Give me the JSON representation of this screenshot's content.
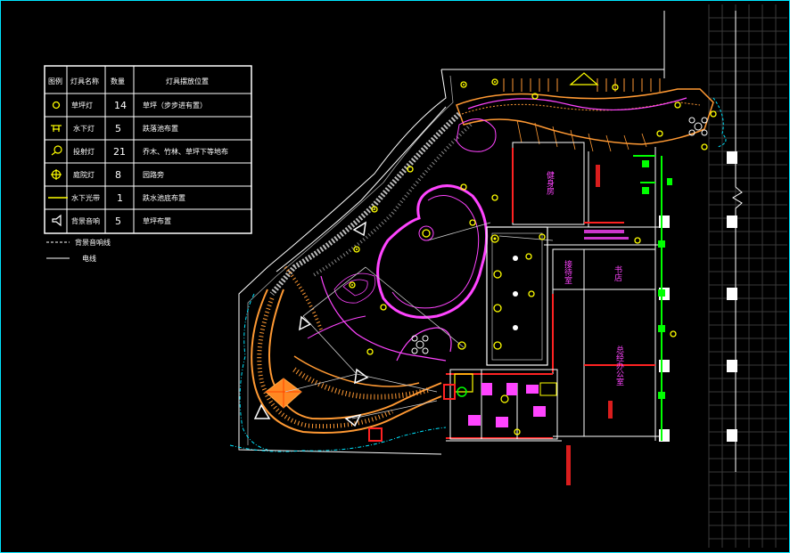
{
  "legend": {
    "headers": {
      "symbol": "图例",
      "name": "灯具名称",
      "qty": "数量",
      "position": "灯具摆放位置"
    },
    "rows": [
      {
        "icon": "lawn-lamp-icon",
        "name": "草坪灯",
        "qty": "14",
        "position": "草坪（步步进有置）"
      },
      {
        "icon": "underwater-lamp-icon",
        "name": "水下灯",
        "qty": "5",
        "position": "跌落池布置"
      },
      {
        "icon": "uplight-icon",
        "name": "投射灯",
        "qty": "21",
        "position": "乔木、竹林、草坪下等地布"
      },
      {
        "icon": "garden-lamp-icon",
        "name": "庭院灯",
        "qty": "8",
        "position": "园路旁"
      },
      {
        "icon": "underwater-strip-icon",
        "name": "水下光带",
        "qty": "1",
        "position": "跌水池底布置"
      },
      {
        "icon": "speaker-icon",
        "name": "背景音响",
        "qty": "5",
        "position": "草坪布置"
      }
    ],
    "line_legend": [
      {
        "name": "背景音响线",
        "style": "dashed"
      },
      {
        "name": "电线",
        "style": "solid"
      }
    ]
  },
  "rooms": [
    {
      "id": "gym",
      "label": "健身房"
    },
    {
      "id": "reception",
      "label": "接待室"
    },
    {
      "id": "bookroom",
      "label": "书店"
    },
    {
      "id": "office",
      "label": "总经办公室"
    }
  ],
  "colors": {
    "frame": "#00e5ff",
    "legend_border": "#ffffff",
    "walls": "#ffffff",
    "paving": "#ff9933",
    "path": "#ff44ff",
    "lamp": "#ffff00",
    "planting": "#00e5ff",
    "green": "#00ff00",
    "red": "#ff2222",
    "grid": "#3a3a3a"
  }
}
